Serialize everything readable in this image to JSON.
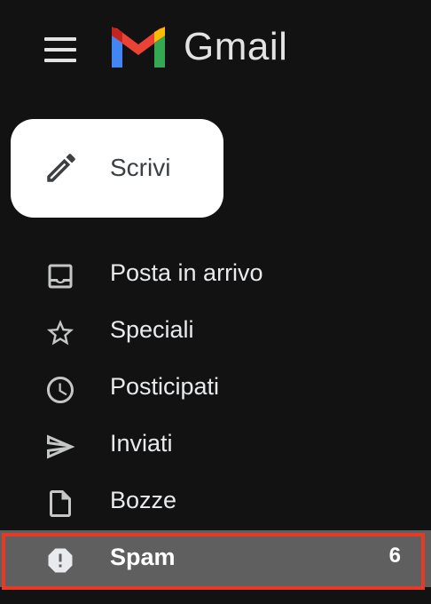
{
  "app": {
    "name": "Gmail"
  },
  "header": {
    "menu_icon": "hamburger-menu-icon",
    "logo_icon": "gmail-m-logo"
  },
  "compose": {
    "label": "Scrivi",
    "icon": "pencil-icon"
  },
  "nav": {
    "items": [
      {
        "label": "Posta in arrivo",
        "icon": "inbox-icon"
      },
      {
        "label": "Speciali",
        "icon": "star-icon"
      },
      {
        "label": "Posticipati",
        "icon": "clock-icon"
      },
      {
        "label": "Inviati",
        "icon": "send-icon"
      },
      {
        "label": "Bozze",
        "icon": "draft-file-icon"
      },
      {
        "label": "Spam",
        "icon": "spam-report-icon",
        "count": "6",
        "active": true
      }
    ]
  },
  "colors": {
    "background": "#121212",
    "active_row": "#5f5f5f",
    "highlight_border": "#e53a24"
  }
}
